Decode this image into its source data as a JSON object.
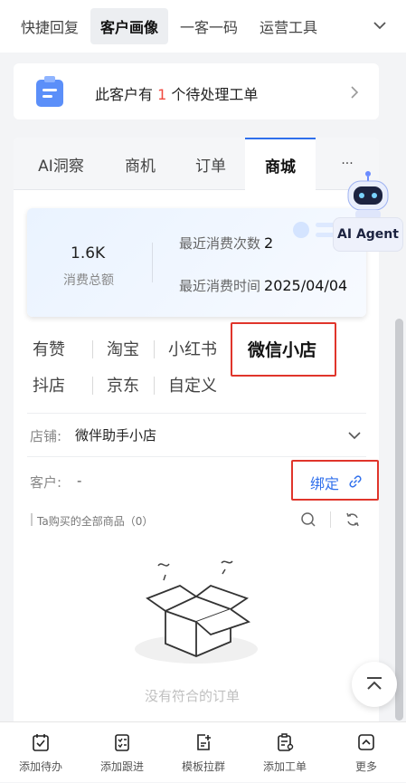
{
  "top_tabs": [
    "快捷回复",
    "客户画像",
    "一客一码",
    "运营工具"
  ],
  "top_tabs_active": "客户画像",
  "notice": {
    "prefix": "此客户有 ",
    "count": "1",
    "suffix": " 个待处理工单"
  },
  "detail_tabs": [
    "AI洞察",
    "商机",
    "订单",
    "商城",
    "···"
  ],
  "detail_tabs_active": "商城",
  "stats": {
    "total_value": "1.6K",
    "total_label": "消费总额",
    "recent_count_label": "最近消费次数",
    "recent_count_value": "2",
    "recent_time_label": "最近消费时间",
    "recent_time_value": "2025/04/04"
  },
  "shops": {
    "row1": [
      "有赞",
      "淘宝",
      "小红书",
      "微信小店"
    ],
    "row2": [
      "抖店",
      "京东",
      "自定义"
    ],
    "selected": "微信小店"
  },
  "store": {
    "label": "店铺:",
    "value": "微伴助手小店"
  },
  "customer": {
    "label": "客户:",
    "value": "-"
  },
  "bind_label": "绑定",
  "products_label": "Ta购买的全部商品（0）",
  "empty_text": "没有符合的订单",
  "agent_label": "AI Agent",
  "bottom_bar": [
    "添加待办",
    "添加跟进",
    "模板拉群",
    "添加工单",
    "更多"
  ],
  "colors": {
    "accent": "#2f6fec",
    "highlight": "#e0352b",
    "count": "#f04a3f"
  }
}
